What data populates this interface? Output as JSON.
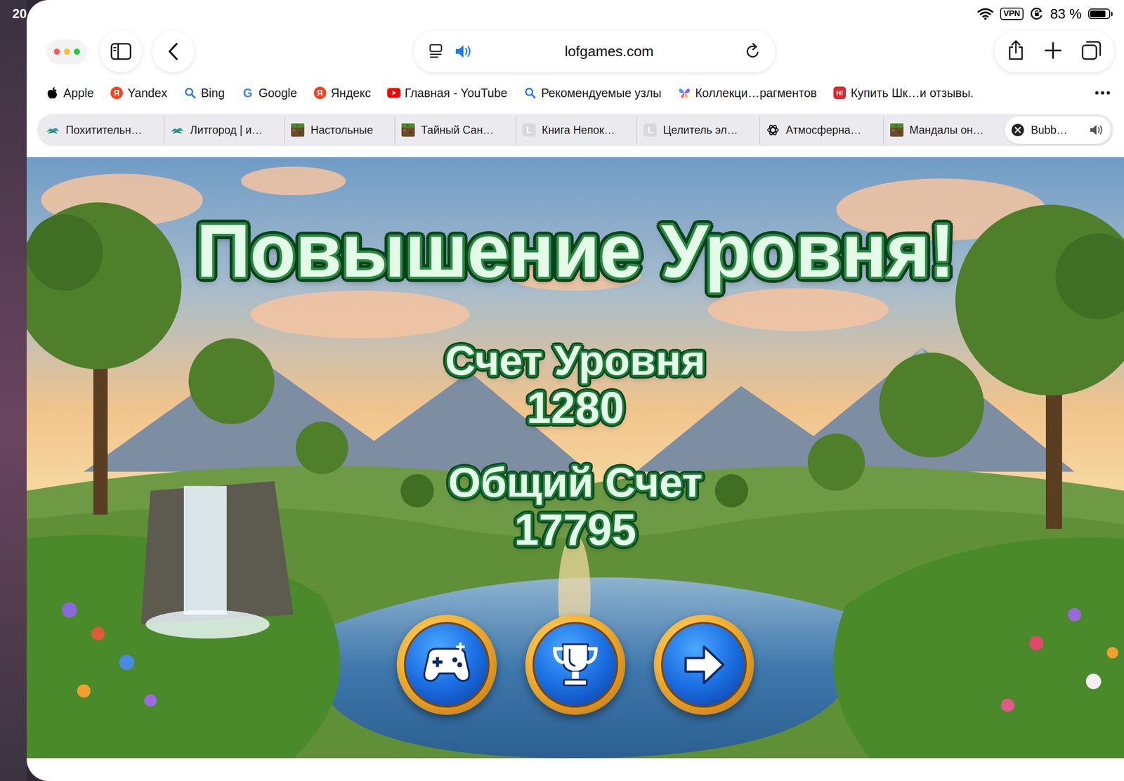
{
  "status_bar": {
    "time": "20",
    "vpn": "VPN",
    "battery": "83 %",
    "battery_level": 0.83
  },
  "toolbar": {
    "url": "lofgames.com",
    "audio_playing": true
  },
  "bookmarks": [
    {
      "label": "Apple",
      "kind": "apple",
      "color": "#000000"
    },
    {
      "label": "Yandex",
      "kind": "letter",
      "icon_text": "Я",
      "color": "#fc3f1d"
    },
    {
      "label": "Bing",
      "kind": "search",
      "color": "#1a73e8"
    },
    {
      "label": "Google",
      "kind": "glyph",
      "icon_text": "G",
      "color": "#4285f4"
    },
    {
      "label": "Яндекс",
      "kind": "letter",
      "icon_text": "Я",
      "color": "#fc3f1d"
    },
    {
      "label": "Главная - YouTube",
      "kind": "youtube",
      "color": "#ff0000"
    },
    {
      "label": "Рекомендуемые узлы",
      "kind": "search",
      "color": "#1a73e8"
    },
    {
      "label": "Коллекци…рагментов",
      "kind": "butterfly",
      "color": "#8a5cf5"
    },
    {
      "label": "Купить Шк…и отзывы.",
      "kind": "letter",
      "icon_text": "Н!",
      "color": "#e3242b"
    }
  ],
  "tabs": [
    {
      "label": "Похитительн…",
      "kind": "bird",
      "selected": false,
      "audio": false
    },
    {
      "label": "Литгород | и…",
      "kind": "bird",
      "selected": false,
      "audio": false
    },
    {
      "label": "Настольные",
      "kind": "block",
      "selected": false,
      "audio": false
    },
    {
      "label": "Тайный Сан…",
      "kind": "block",
      "selected": false,
      "audio": false
    },
    {
      "label": "Книга Непок…",
      "kind": "letter",
      "icon_text": "L",
      "selected": false,
      "audio": false
    },
    {
      "label": "Целитель эл…",
      "kind": "letter",
      "icon_text": "L",
      "selected": false,
      "audio": false
    },
    {
      "label": "Атмосферна…",
      "kind": "openai",
      "selected": false,
      "audio": false
    },
    {
      "label": "Мандалы он…",
      "kind": "block",
      "selected": false,
      "audio": false
    },
    {
      "label": "Bubb…",
      "kind": "close",
      "selected": true,
      "audio": true
    }
  ],
  "game": {
    "title": "Повышение Уровня!",
    "level_score_label": "Счет Уровня",
    "level_score": "1280",
    "total_label": "Общий Счет",
    "total_score": "17795"
  }
}
